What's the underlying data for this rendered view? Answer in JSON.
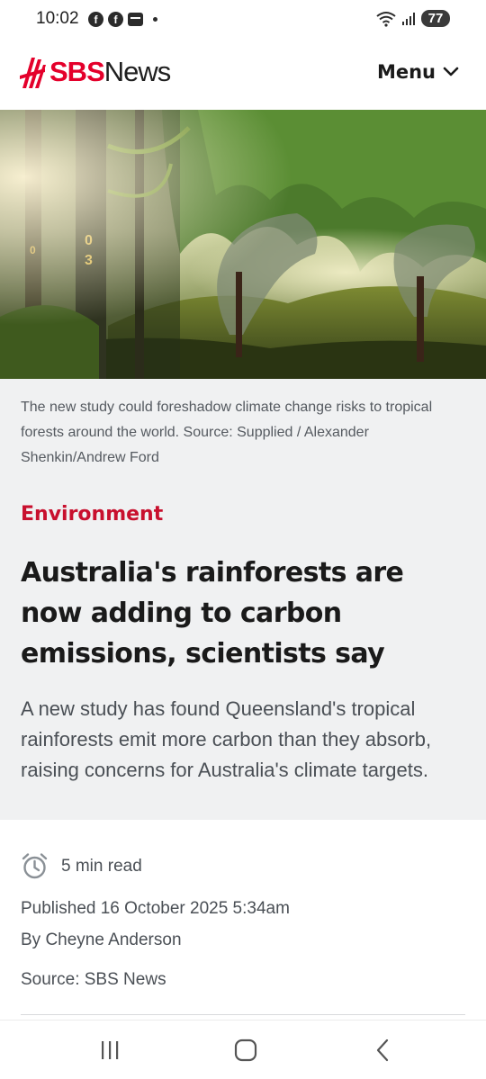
{
  "status_bar": {
    "time": "10:02",
    "battery": "77",
    "left_icons": [
      "facebook-icon",
      "facebook-icon",
      "mail-icon",
      "dot-icon"
    ],
    "right_icons": [
      "wifi-icon",
      "signal-icon",
      "battery-icon"
    ]
  },
  "header": {
    "logo_sbs": "SBS",
    "logo_news": "News",
    "menu_label": "Menu",
    "brand_color": "#e4002b"
  },
  "article": {
    "image_caption": "The new study could foreshadow climate change risks to tropical forests around the world. Source: Supplied / Alexander Shenkin/Andrew Ford",
    "category": "Environment",
    "category_color": "#c8102e",
    "headline": "Australia's rainforests are now adding to carbon emissions, scientists say",
    "standfirst": "A new study has found Queensland's tropical rainforests emit more carbon than they absorb, raising concerns for Australia's climate targets.",
    "read_time": "5 min read",
    "published": "Published 16 October 2025 5:34am",
    "byline": "By Cheyne Anderson",
    "source": "Source: SBS News"
  },
  "nav_bar": {
    "buttons": [
      "recent-apps-button",
      "home-button",
      "back-button"
    ]
  }
}
